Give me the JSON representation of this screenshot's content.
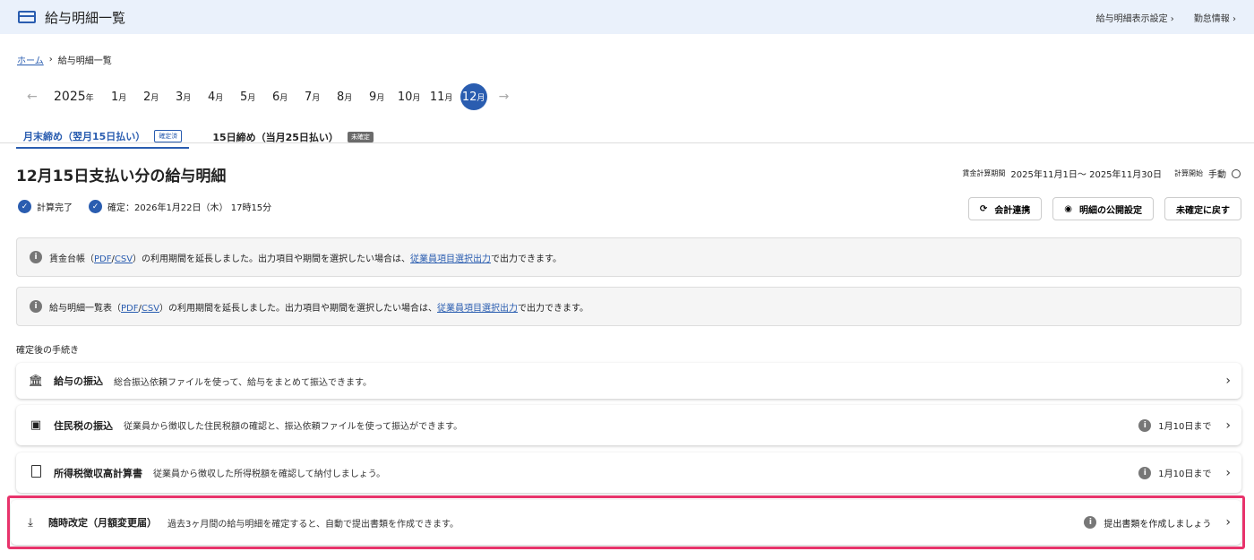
{
  "header": {
    "title": "給与明細一覧",
    "links": [
      "給与明細表示設定",
      "勤怠情報"
    ]
  },
  "breadcrumb": {
    "home": "ホーム",
    "current": "給与明細一覧"
  },
  "months": {
    "year": "2025",
    "year_unit": "年",
    "unit": "月",
    "items": [
      "1",
      "2",
      "3",
      "4",
      "5",
      "6",
      "7",
      "8",
      "9",
      "10",
      "11"
    ],
    "active": "12"
  },
  "tabs": [
    {
      "label": "月末締め（翌月15日払い）",
      "badge": "確定済"
    },
    {
      "label": "15日締め（当月25日払い）",
      "badge": "未確定"
    }
  ],
  "page": {
    "heading": "12月15日支払い分の給与明細",
    "period_label": "賃金計算期間",
    "period_value": "2025年11月1日～ 2025年11月30日",
    "calc_start_label": "計算開始",
    "calc_start_value": "手動"
  },
  "status": {
    "calc": "計算完了",
    "confirmed": "確定：2026年1月22日（木） 17時15分"
  },
  "actions": {
    "accounting": "会計連携",
    "publish": "明細の公開設定",
    "revert": "未確定に戻す"
  },
  "notices": [
    {
      "prefix": "賃金台帳（",
      "pdf": "PDF",
      "sep": "/",
      "csv": "CSV",
      "middle": "）の利用期間を延長しました。出力項目や期間を選択したい場合は、",
      "link": "従業員項目選択出力",
      "suffix": "で出力できます。"
    },
    {
      "prefix": "給与明細一覧表（",
      "pdf": "PDF",
      "sep": "/",
      "csv": "CSV",
      "middle": "）の利用期間を延長しました。出力項目や期間を選択したい場合は、",
      "link": "従業員項目選択出力",
      "suffix": "で出力できます。"
    }
  ],
  "section_label": "確定後の手続き",
  "procedures": [
    {
      "title": "給与の振込",
      "desc": "総合振込依頼ファイルを使って、給与をまとめて振込できます。",
      "deadline": ""
    },
    {
      "title": "住民税の振込",
      "desc": "従業員から徴収した住民税額の確認と、振込依頼ファイルを使って振込ができます。",
      "deadline": "1月10日まで"
    },
    {
      "title": "所得税徴収高計算書",
      "desc": "従業員から徴収した所得税額を確認して納付しましょう。",
      "deadline": "1月10日まで"
    },
    {
      "title": "随時改定（月額変更届）",
      "desc": "過去3ヶ月間の給与明細を確定すると、自動で提出書類を作成できます。",
      "deadline": "提出書類を作成しましょう"
    }
  ],
  "colors": {
    "accent": "#2a5db0",
    "highlight": "#e8336b",
    "header_bg": "#eaf1fb"
  }
}
